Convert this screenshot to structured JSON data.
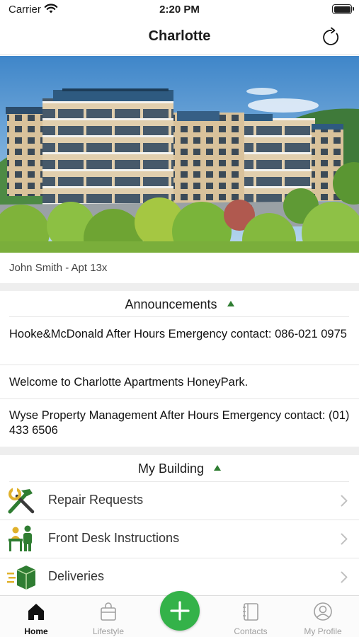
{
  "status_bar": {
    "carrier": "Carrier",
    "time": "2:20 PM"
  },
  "header": {
    "title": "Charlotte"
  },
  "tenant": {
    "label": "John Smith - Apt 13x"
  },
  "announcements": {
    "title": "Announcements",
    "items": [
      {
        "text": "Hooke&McDonald After Hours Emergency contact: 086-021 0975"
      },
      {
        "text": "Welcome to Charlotte Apartments HoneyPark."
      },
      {
        "text": "Wyse Property Management After Hours Emergency contact: (01) 433 6506"
      }
    ]
  },
  "building": {
    "title": "My Building",
    "items": [
      {
        "label": "Repair Requests",
        "icon": "tools-icon"
      },
      {
        "label": "Front Desk Instructions",
        "icon": "front-desk-icon"
      },
      {
        "label": "Deliveries",
        "icon": "package-icon"
      }
    ]
  },
  "tabs": [
    {
      "label": "Home",
      "icon": "home-icon",
      "active": true
    },
    {
      "label": "Lifestyle",
      "icon": "bag-icon",
      "active": false
    },
    {
      "label": "Contacts",
      "icon": "notebook-icon",
      "active": false
    },
    {
      "label": "My Profile",
      "icon": "profile-icon",
      "active": false
    }
  ],
  "colors": {
    "accent": "#34b249",
    "caret": "#2f7d32",
    "section_gap": "#eeeeee"
  }
}
